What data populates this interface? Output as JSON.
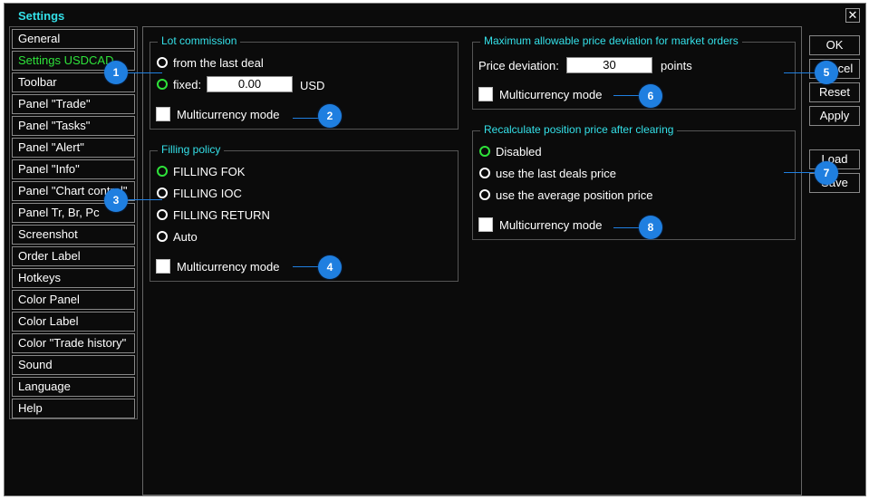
{
  "window": {
    "title": "Settings",
    "close_glyph": "✕"
  },
  "nav": {
    "items": [
      {
        "label": "General"
      },
      {
        "label": "Settings USDCAD"
      },
      {
        "label": "Toolbar"
      },
      {
        "label": "Panel \"Trade\""
      },
      {
        "label": "Panel \"Tasks\""
      },
      {
        "label": "Panel \"Alert\""
      },
      {
        "label": "Panel \"Info\""
      },
      {
        "label": "Panel \"Chart control\""
      },
      {
        "label": "Panel Tr, Br, Pc"
      },
      {
        "label": "Screenshot"
      },
      {
        "label": "Order Label"
      },
      {
        "label": "Hotkeys"
      },
      {
        "label": "Color Panel"
      },
      {
        "label": "Color Label"
      },
      {
        "label": "Color \"Trade history\""
      },
      {
        "label": "Sound"
      },
      {
        "label": "Language"
      },
      {
        "label": "Help"
      }
    ],
    "active_index": 1
  },
  "lot_commission": {
    "title": "Lot commission",
    "opt_last": "from the last deal",
    "opt_fixed": "fixed:",
    "fixed_value": "0.00",
    "currency": "USD",
    "multicurrency": "Multicurrency mode"
  },
  "filling_policy": {
    "title": "Filling policy",
    "options": [
      "FILLING FOK",
      "FILLING IOC",
      "FILLING RETURN",
      "Auto"
    ],
    "selected": "FILLING FOK",
    "multicurrency": "Multicurrency mode"
  },
  "price_deviation": {
    "title": "Maximum allowable price deviation for market orders",
    "label": "Price deviation:",
    "value": "30",
    "unit": "points",
    "multicurrency": "Multicurrency mode"
  },
  "recalculate": {
    "title": "Recalculate position price after clearing",
    "options": [
      "Disabled",
      "use the last deals price",
      "use the average position price"
    ],
    "selected": "Disabled",
    "multicurrency": "Multicurrency mode"
  },
  "buttons": {
    "ok": "OK",
    "cancel": "Cancel",
    "reset": "Reset",
    "apply": "Apply",
    "load": "Load",
    "save": "Save"
  },
  "badges": [
    "1",
    "2",
    "3",
    "4",
    "5",
    "6",
    "7",
    "8"
  ],
  "colors": {
    "accent": "#34e0e8",
    "active": "#2ee33a",
    "badge": "#1f7fe0",
    "background": "#0b0b0b"
  }
}
